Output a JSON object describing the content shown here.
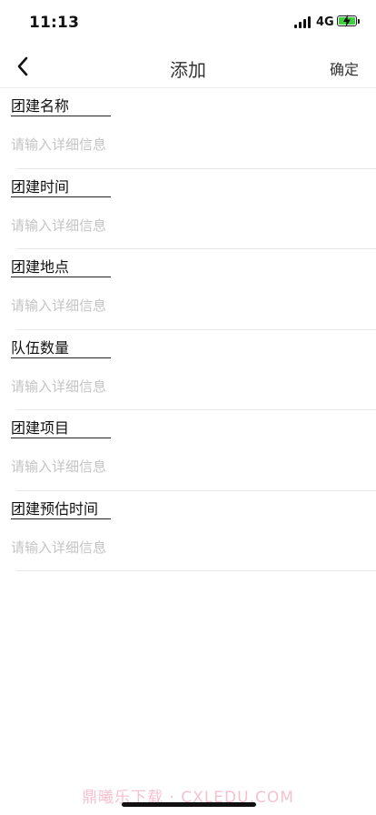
{
  "status_bar": {
    "time": "11:13",
    "network": "4G",
    "battery_icon": "battery-charging-icon",
    "battery_color": "#3fcf3f"
  },
  "nav": {
    "back_icon": "chevron-left-icon",
    "title": "添加",
    "confirm_label": "确定"
  },
  "form": {
    "fields": [
      {
        "label": "团建名称",
        "placeholder": "请输入详细信息",
        "value": ""
      },
      {
        "label": "团建时间",
        "placeholder": "请输入详细信息",
        "value": ""
      },
      {
        "label": "团建地点",
        "placeholder": "请输入详细信息",
        "value": ""
      },
      {
        "label": "队伍数量",
        "placeholder": "请输入详细信息",
        "value": ""
      },
      {
        "label": "团建项目",
        "placeholder": "请输入详细信息",
        "value": ""
      },
      {
        "label": "团建预估时间",
        "placeholder": "请输入详细信息",
        "value": ""
      }
    ]
  },
  "watermark": "鼎曦乐下载 · CXLEDU.COM"
}
